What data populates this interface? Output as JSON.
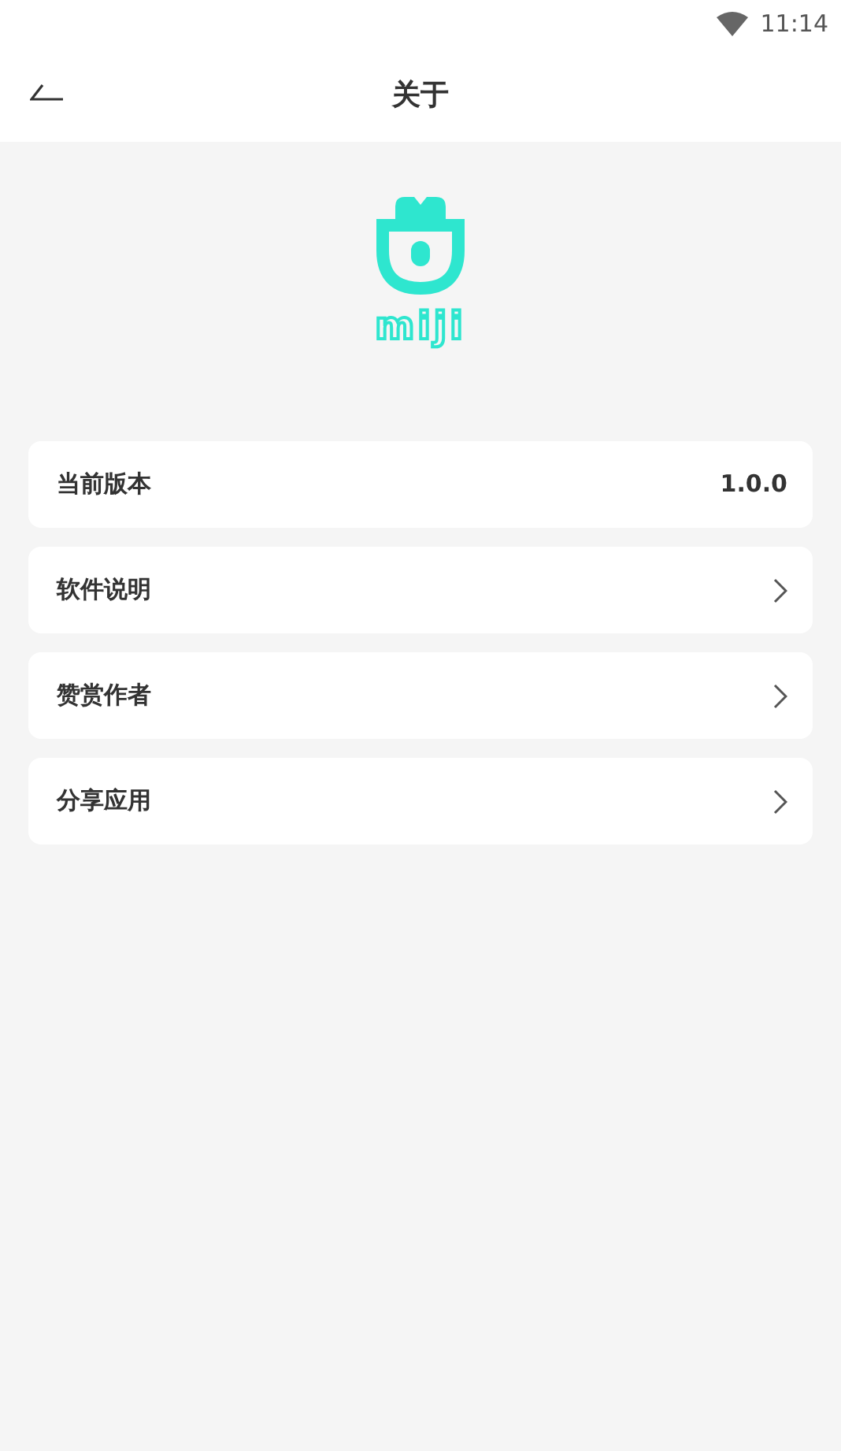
{
  "status_bar": {
    "time": "11:14"
  },
  "header": {
    "title": "关于"
  },
  "logo": {
    "wordmark": "miji"
  },
  "rows": [
    {
      "kind": "value",
      "label": "当前版本",
      "value": "1.0.0"
    },
    {
      "kind": "link",
      "label": "软件说明"
    },
    {
      "kind": "link",
      "label": "赞赏作者"
    },
    {
      "kind": "link",
      "label": "分享应用"
    }
  ]
}
